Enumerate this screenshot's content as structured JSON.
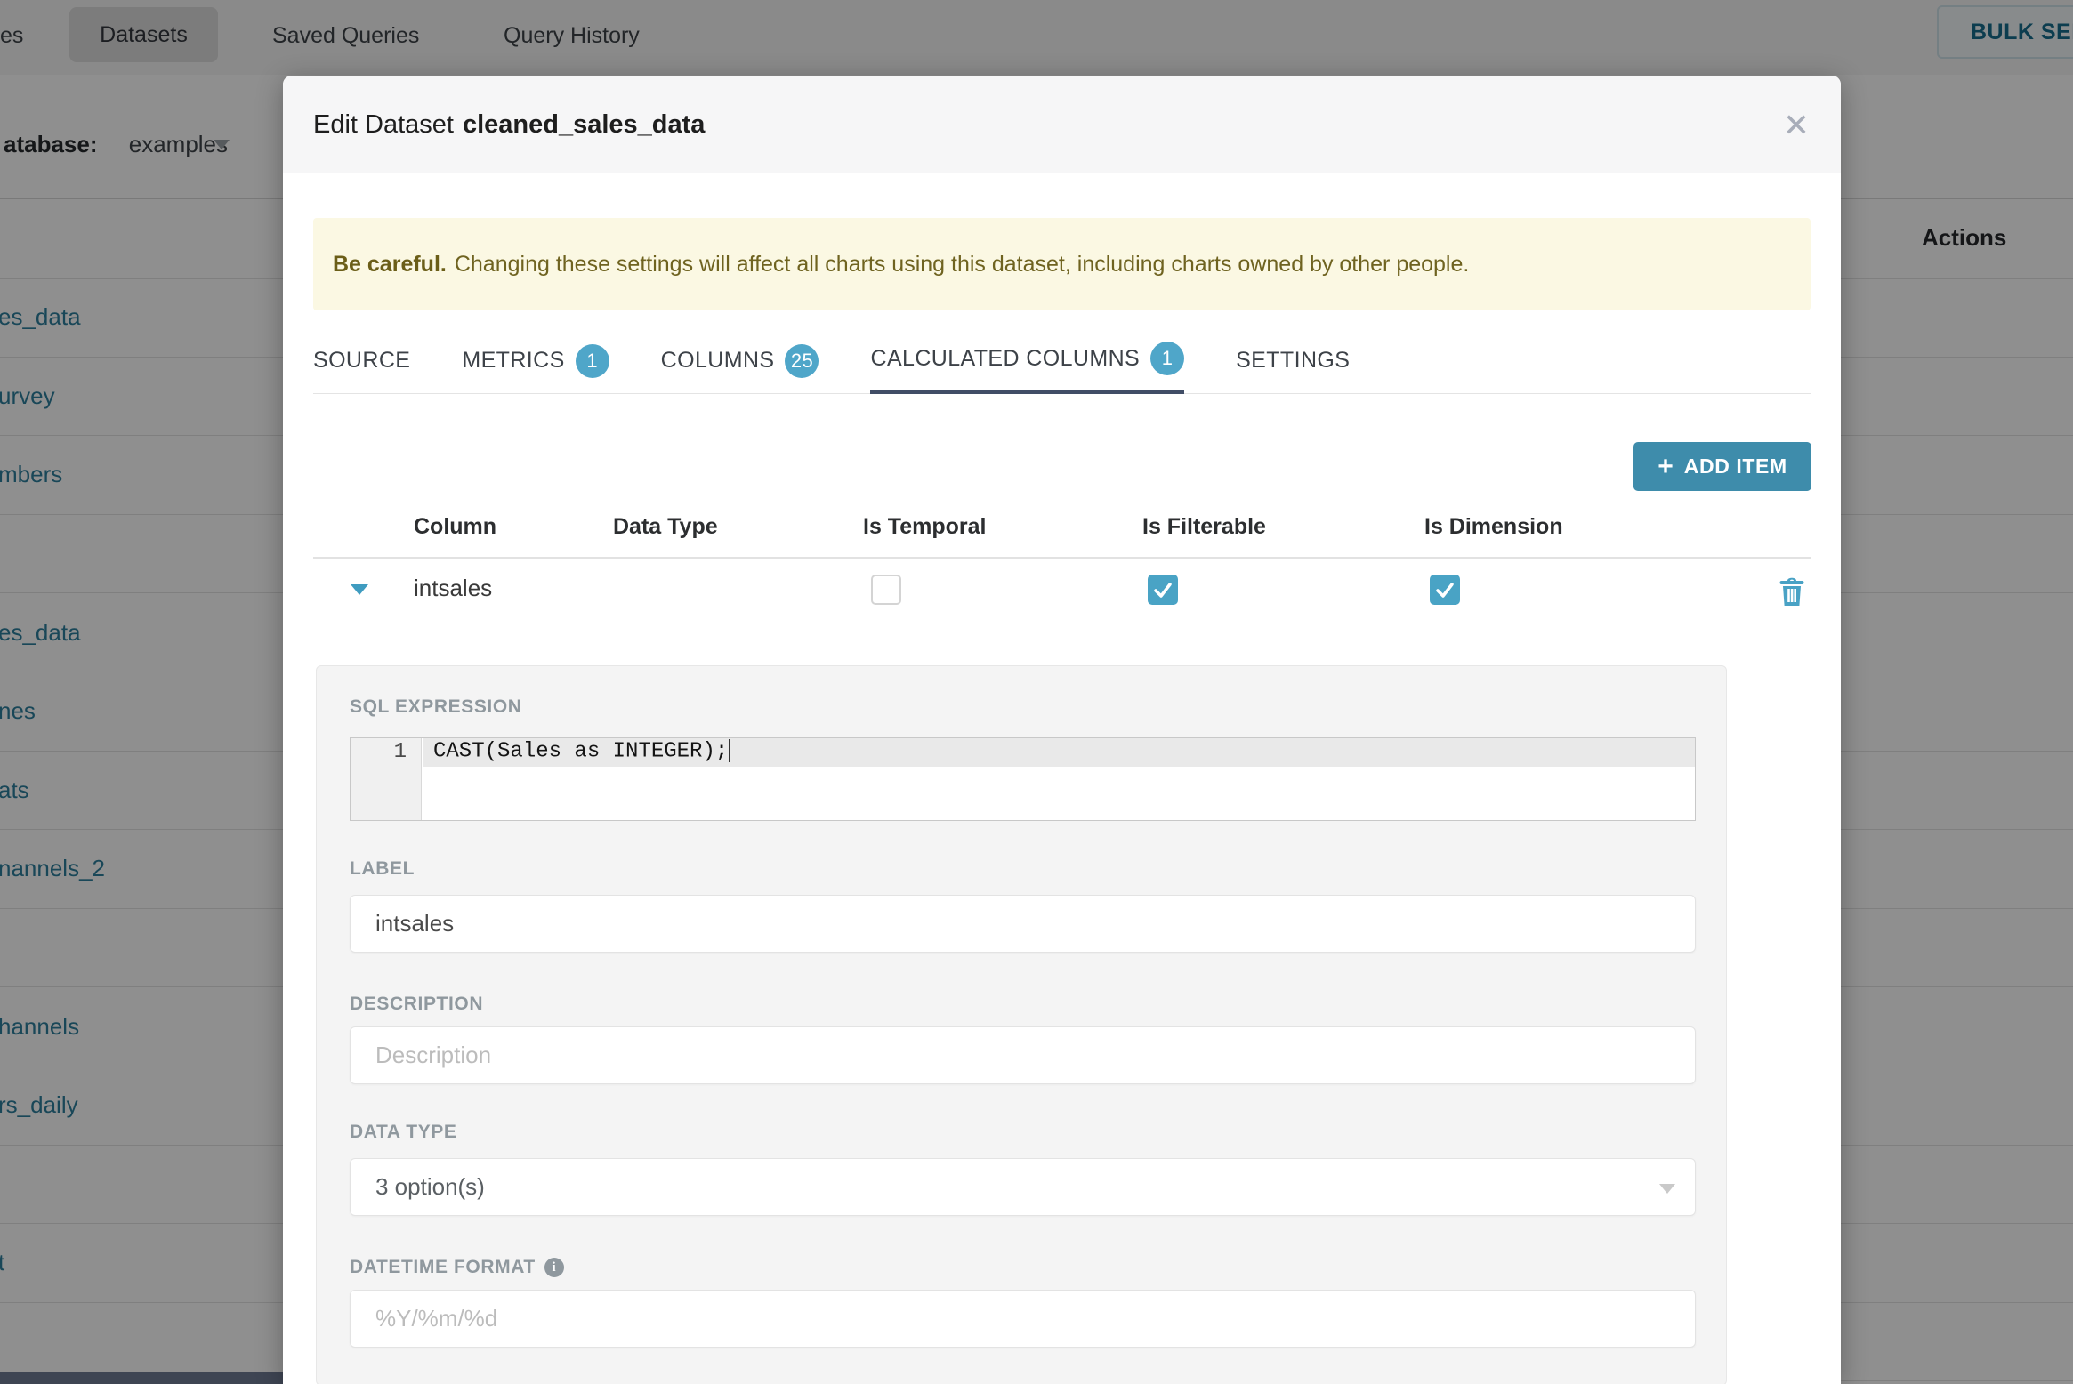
{
  "colors": {
    "accent": "#3e8cab",
    "badge": "#4fa6c9",
    "checkbox": "#49a3c5",
    "link": "#2d7f9d",
    "tab-underline": "#414d66",
    "warning-bg": "#fbf8e3",
    "warning-text": "#6b5e18"
  },
  "nav": {
    "partial_tab": "es",
    "datasets_tab": "Datasets",
    "saved_queries_tab": "Saved Queries",
    "query_history_tab": "Query History",
    "bulk_select_button": "BULK SELECT",
    "database_label": "atabase:",
    "database_value": "examples"
  },
  "background_table": {
    "actions_header": "Actions",
    "rows": [
      "es_data",
      "urvey",
      "mbers",
      "",
      "es_data",
      "nes",
      "ats",
      "nannels_2",
      "",
      "hannels",
      "rs_daily",
      "",
      "t",
      ""
    ]
  },
  "modal": {
    "title_prefix": "Edit Dataset",
    "dataset_name": "cleaned_sales_data",
    "close_icon": "✕",
    "warning": {
      "bold": "Be careful.",
      "text": "Changing these settings will affect all charts using this dataset, including charts owned by other people."
    },
    "tabs": {
      "source": "SOURCE",
      "metrics": "METRICS",
      "metrics_badge": "1",
      "columns": "COLUMNS",
      "columns_badge": "25",
      "calculated": "CALCULATED COLUMNS",
      "calculated_badge": "1",
      "settings": "SETTINGS"
    },
    "add_item_plus": "+",
    "add_item_button": "ADD ITEM",
    "grid": {
      "col_column": "Column",
      "col_data_type": "Data Type",
      "col_is_temporal": "Is Temporal",
      "col_is_filterable": "Is Filterable",
      "col_is_dimension": "Is Dimension",
      "row_name": "intsales",
      "is_temporal": false,
      "is_filterable": true,
      "is_dimension": true
    },
    "editor": {
      "section_label": "SQL EXPRESSION",
      "line_number": "1",
      "code": "CAST(Sales as INTEGER);"
    },
    "fields": {
      "label_label": "LABEL",
      "label_value": "intsales",
      "description_label": "DESCRIPTION",
      "description_placeholder": "Description",
      "data_type_label": "DATA TYPE",
      "data_type_value": "3 option(s)",
      "datetime_label": "DATETIME FORMAT",
      "datetime_info_icon": "i",
      "datetime_placeholder": "%Y/%m/%d"
    }
  }
}
